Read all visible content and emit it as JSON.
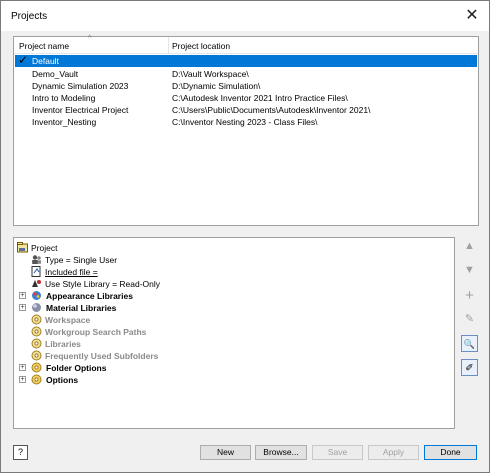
{
  "window": {
    "title": "Projects",
    "close_label": "✕"
  },
  "list": {
    "columns": {
      "name": "Project name",
      "location": "Project location"
    },
    "rows": [
      {
        "name": "Default",
        "location": ""
      },
      {
        "name": "Demo_Vault",
        "location": "D:\\Vault Workspace\\"
      },
      {
        "name": "Dynamic Simulation 2023",
        "location": "D:\\Dynamic Simulation\\"
      },
      {
        "name": "Intro to Modeling",
        "location": "C:\\Autodesk Inventor 2021 Intro Practice Files\\"
      },
      {
        "name": "Inventor Electrical Project",
        "location": "C:\\Users\\Public\\Documents\\Autodesk\\Inventor 2021\\"
      },
      {
        "name": "Inventor_Nesting",
        "location": "C:\\Inventor Nesting 2023 - Class Files\\"
      }
    ],
    "selected_index": 0,
    "check_mark": "✓"
  },
  "tree": {
    "root": "Project",
    "type": "Type = Single User",
    "included": "Included file =",
    "style_lib": "Use Style Library = Read-Only",
    "appearance": "Appearance Libraries",
    "material": "Material Libraries",
    "workspace": "Workspace",
    "workgroup": "Workgroup Search Paths",
    "libraries": "Libraries",
    "frequent": "Frequently Used Subfolders",
    "folder_options": "Folder Options",
    "options": "Options"
  },
  "side_buttons": {
    "up": "▲",
    "down": "▼",
    "add": "+",
    "edit": "✎",
    "find": "🔍",
    "edit_text": "✐"
  },
  "buttons": {
    "help": "?",
    "new": "New",
    "browse": "Browse...",
    "save": "Save",
    "apply": "Apply",
    "done": "Done"
  },
  "colors": {
    "selection": "#0078d7",
    "disabled_text": "#a0a0a0"
  }
}
